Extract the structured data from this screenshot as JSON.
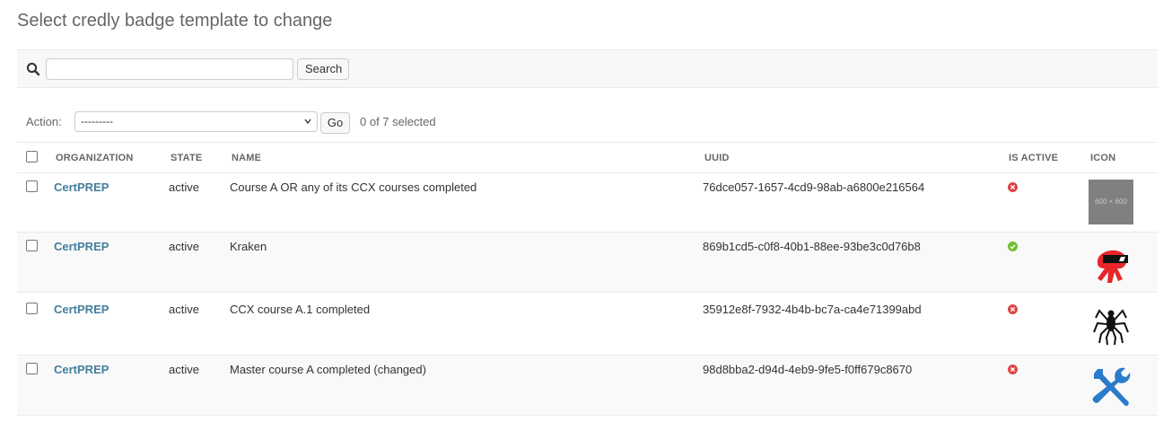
{
  "page": {
    "title": "Select credly badge template to change"
  },
  "search": {
    "value": "",
    "placeholder": "",
    "button_label": "Search"
  },
  "actions": {
    "label": "Action:",
    "selected_option": "---------",
    "go_label": "Go",
    "selected_count": "0 of 7 selected"
  },
  "table": {
    "headers": {
      "organization": "ORGANIZATION",
      "state": "STATE",
      "name": "NAME",
      "uuid": "UUID",
      "is_active": "IS ACTIVE",
      "icon": "ICON"
    },
    "rows": [
      {
        "organization": "CertPREP",
        "state": "active",
        "name": "Course A OR any of its CCX courses completed",
        "uuid": "76dce057-1657-4cd9-98ab-a6800e216564",
        "is_active": false,
        "icon": "placeholder-image",
        "icon_text": "600 × 600"
      },
      {
        "organization": "CertPREP",
        "state": "active",
        "name": "Kraken",
        "uuid": "869b1cd5-c0f8-40b1-88ee-93be3c0d76b8",
        "is_active": true,
        "icon": "kraken-icon"
      },
      {
        "organization": "CertPREP",
        "state": "active",
        "name": "CCX course A.1 completed",
        "uuid": "35912e8f-7932-4b4b-bc7a-ca4e71399abd",
        "is_active": false,
        "icon": "spider-icon"
      },
      {
        "organization": "CertPREP",
        "state": "active",
        "name": "Master course A completed (changed)",
        "uuid": "98d8bba2-d94d-4eb9-9fe5-f0ff679c8670",
        "is_active": false,
        "icon": "tools-icon"
      }
    ]
  },
  "colors": {
    "link": "#447e9b",
    "active_yes": "#70bf2b",
    "active_no": "#dd4646",
    "toolbar_bg": "#f8f8f8",
    "alt_row_bg": "#f9f9f9"
  }
}
